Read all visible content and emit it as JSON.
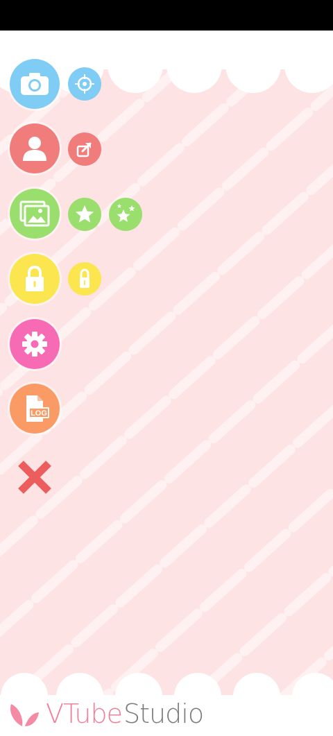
{
  "app": {
    "name_part1": "VTube",
    "name_part2": "Studio"
  },
  "colors": {
    "pink_bg": "#fde3e3",
    "stripe": "#fff1f1",
    "camera": "#7fccf5",
    "profile": "#f07c7c",
    "background": "#9adf6e",
    "lock": "#fbe650",
    "settings": "#f76bb5",
    "log": "#fa9a64",
    "close": "#ec5e5e",
    "logo_pink": "#f07f9a",
    "logo_gray": "#7b7b7b"
  },
  "menu": [
    {
      "id": "camera",
      "icon": "camera-icon",
      "sub": [
        "crosshair-icon"
      ]
    },
    {
      "id": "profile",
      "icon": "person-icon",
      "sub": [
        "export-icon"
      ]
    },
    {
      "id": "background",
      "icon": "image-icon",
      "sub": [
        "star-icon",
        "stars-icon"
      ]
    },
    {
      "id": "lock",
      "icon": "lock-icon",
      "sub": [
        "small-lock-icon"
      ]
    },
    {
      "id": "settings",
      "icon": "gear-icon",
      "sub": []
    },
    {
      "id": "log",
      "icon": "log-file-icon",
      "sub": []
    }
  ],
  "log_badge": "LOG"
}
